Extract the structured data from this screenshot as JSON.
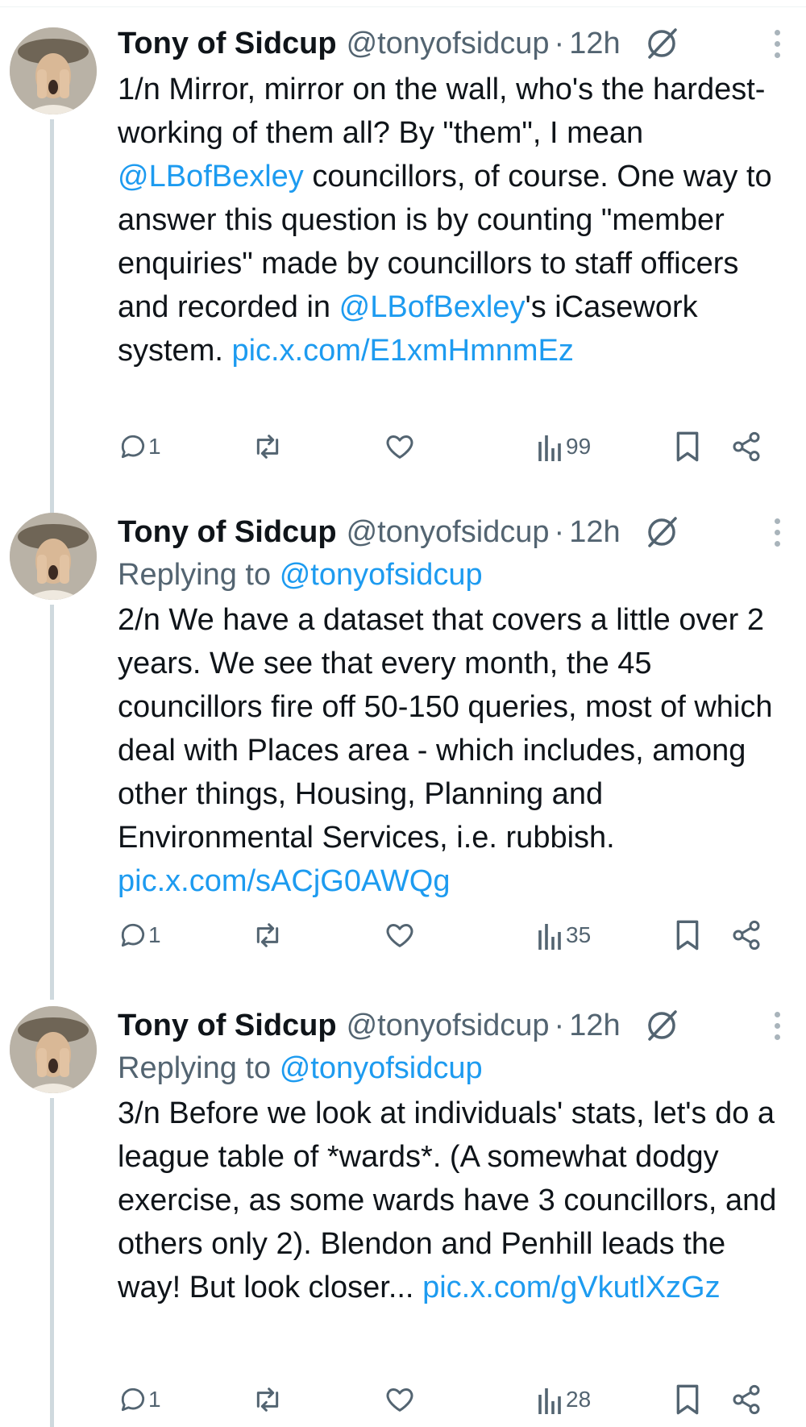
{
  "tweets": [
    {
      "name": "Tony of Sidcup",
      "handle": "@tonyofsidcup",
      "time": "12h",
      "replying_label": "",
      "replying_handle": "",
      "text": [
        {
          "t": "1/n Mirror, mirror on the wall, who's the hardest-working of them all? By \"them\", I mean "
        },
        {
          "t": "@LBofBexley",
          "link": true
        },
        {
          "t": " councillors, of course. One way to answer this question is by counting \"member enquiries\" made by councillors to staff officers and recorded in "
        },
        {
          "t": "@LBofBexley",
          "link": true
        },
        {
          "t": "'s iCasework system. "
        },
        {
          "t": "pic.x.com/E1xmHmnmEz",
          "link": true
        }
      ],
      "replies": "1",
      "views": "99"
    },
    {
      "name": "Tony of Sidcup",
      "handle": "@tonyofsidcup",
      "time": "12h",
      "replying_label": "Replying to",
      "replying_handle": "@tonyofsidcup",
      "text": [
        {
          "t": "2/n We have a dataset that covers a little over 2 years. We see that every month, the 45 councillors fire off 50-150 queries, most of which deal with Places area - which includes, among other things, Housing, Planning and Environmental Services, i.e. rubbish. "
        },
        {
          "t": "pic.x.com/sACjG0AWQg",
          "link": true
        }
      ],
      "replies": "1",
      "views": "35"
    },
    {
      "name": "Tony of Sidcup",
      "handle": "@tonyofsidcup",
      "time": "12h",
      "replying_label": "Replying to",
      "replying_handle": "@tonyofsidcup",
      "text": [
        {
          "t": "3/n Before we look at individuals' stats, let's do a league table of *wards*.  (A somewhat dodgy exercise, as some wards have 3 councillors, and others only 2). Blendon and Penhill leads the way! But look closer... "
        },
        {
          "t": "pic.x.com/gVkutlXzGz",
          "link": true
        }
      ],
      "replies": "1",
      "views": "28"
    }
  ],
  "colors": {
    "text": "#0f1419",
    "secondary": "#536471",
    "link": "#1d9bf0",
    "thread_line": "#cfd9de"
  }
}
